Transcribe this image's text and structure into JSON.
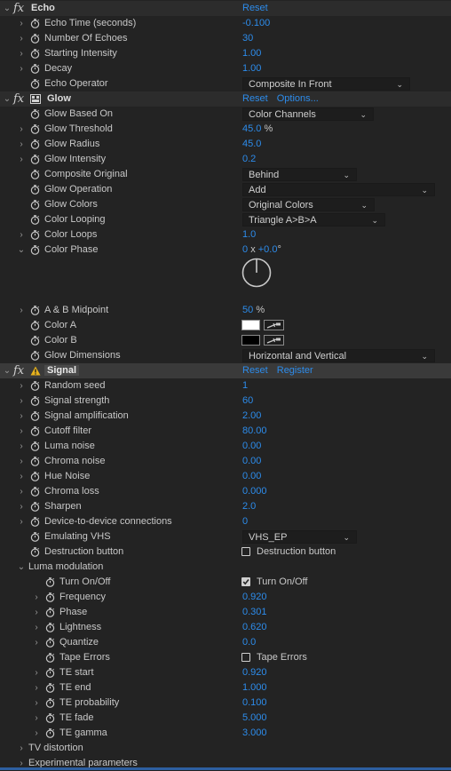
{
  "icons": {
    "fx": "fx-icon",
    "stopwatch": "stopwatch-icon",
    "twirl_right": "chevron-right-icon",
    "twirl_down": "chevron-down-icon",
    "dropdown": "chevron-down-icon",
    "eyedropper": "eyedropper-icon",
    "warning": "warning-icon",
    "plugin": "plugin-icon"
  },
  "colors": {
    "value_blue": "#2d8ceb",
    "color_a": "#ffffff",
    "color_b": "#000000"
  },
  "glyphs": {
    "fx": "fx",
    "twirl_right": "›",
    "twirl_down": "⌄",
    "dd_chev": "⌄"
  },
  "echo": {
    "name": "Echo",
    "reset": "Reset",
    "params": [
      {
        "label": "Echo Time (seconds)",
        "value": "-0.100"
      },
      {
        "label": "Number Of Echoes",
        "value": "30"
      },
      {
        "label": "Starting Intensity",
        "value": "1.00"
      },
      {
        "label": "Decay",
        "value": "1.00"
      }
    ],
    "operator": {
      "label": "Echo Operator",
      "value": "Composite In Front"
    }
  },
  "glow": {
    "name": "Glow",
    "reset": "Reset",
    "options": "Options...",
    "based_on": {
      "label": "Glow Based On",
      "value": "Color Channels"
    },
    "threshold": {
      "label": "Glow Threshold",
      "value": "45.0",
      "unit": "%"
    },
    "radius": {
      "label": "Glow Radius",
      "value": "45.0"
    },
    "intensity": {
      "label": "Glow Intensity",
      "value": "0.2"
    },
    "composite": {
      "label": "Composite Original",
      "value": "Behind"
    },
    "operation": {
      "label": "Glow Operation",
      "value": "Add"
    },
    "colors": {
      "label": "Glow Colors",
      "value": "Original Colors"
    },
    "looping": {
      "label": "Color Looping",
      "value": "Triangle A>B>A"
    },
    "loops": {
      "label": "Color Loops",
      "value": "1.0"
    },
    "phase": {
      "label": "Color Phase",
      "revs": "0",
      "x": "x",
      "deg": "+0.0",
      "degsym": "°"
    },
    "midpoint": {
      "label": "A & B Midpoint",
      "value": "50",
      "unit": "%"
    },
    "color_a": {
      "label": "Color A"
    },
    "color_b": {
      "label": "Color B"
    },
    "dimensions": {
      "label": "Glow Dimensions",
      "value": "Horizontal and Vertical"
    }
  },
  "signal": {
    "name": "Signal",
    "reset": "Reset",
    "register": "Register",
    "params": [
      {
        "label": "Random seed",
        "value": "1"
      },
      {
        "label": "Signal strength",
        "value": "60"
      },
      {
        "label": "Signal amplification",
        "value": "2.00"
      },
      {
        "label": "Cutoff filter",
        "value": "80.00"
      },
      {
        "label": "Luma noise",
        "value": "0.00"
      },
      {
        "label": "Chroma noise",
        "value": "0.00"
      },
      {
        "label": "Hue Noise",
        "value": "0.00"
      },
      {
        "label": "Chroma loss",
        "value": "0.000"
      },
      {
        "label": "Sharpen",
        "value": "2.0"
      },
      {
        "label": "Device-to-device connections",
        "value": "0"
      }
    ],
    "vhs": {
      "label": "Emulating VHS",
      "value": "VHS_EP"
    },
    "destruction": {
      "label": "Destruction button",
      "cb_label": "Destruction button"
    },
    "luma": {
      "label": "Luma modulation",
      "turn": {
        "label": "Turn On/Off",
        "cb_label": "Turn On/Off"
      },
      "params": [
        {
          "label": "Frequency",
          "value": "0.920"
        },
        {
          "label": "Phase",
          "value": "0.301"
        },
        {
          "label": "Lightness",
          "value": "0.620"
        },
        {
          "label": "Quantize",
          "value": "0.0"
        }
      ],
      "tape": {
        "label": "Tape Errors",
        "cb_label": "Tape Errors"
      },
      "te": [
        {
          "label": "TE start",
          "value": "0.920"
        },
        {
          "label": "TE end",
          "value": "1.000"
        },
        {
          "label": "TE probability",
          "value": "0.100"
        },
        {
          "label": "TE fade",
          "value": "5.000"
        },
        {
          "label": "TE gamma",
          "value": "3.000"
        }
      ]
    },
    "tv_distortion": "TV distortion",
    "experimental": "Experimental parameters"
  }
}
